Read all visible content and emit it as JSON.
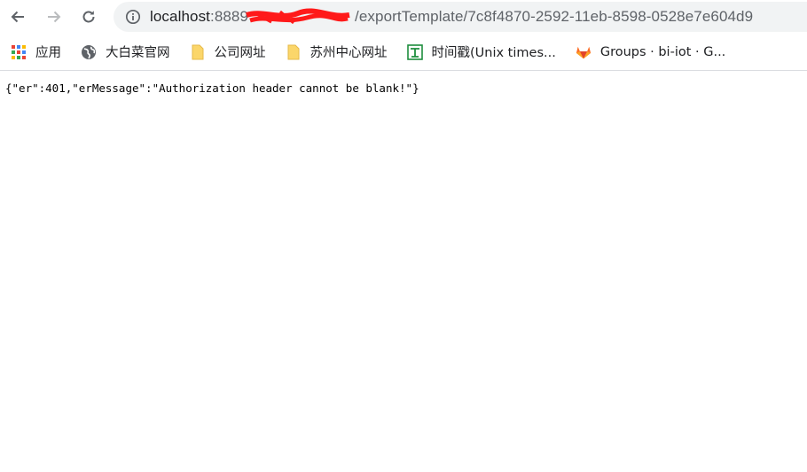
{
  "browser": {
    "url": {
      "host": "localhost",
      "port": ":8889",
      "rest": "/exportTemplate/7c8f4870-2592-11eb-8598-0528e7e604d9"
    }
  },
  "bookmarks": [
    {
      "label": "应用",
      "icon": "apps-grid-icon"
    },
    {
      "label": "大白菜官网",
      "icon": "globe-icon"
    },
    {
      "label": "公司网址",
      "icon": "folder-icon"
    },
    {
      "label": "苏州中心网址",
      "icon": "folder-icon"
    },
    {
      "label": "时间戳(Unix times...",
      "icon": "timestamp-icon"
    },
    {
      "label": "Groups · bi-iot · G...",
      "icon": "gitlab-icon"
    }
  ],
  "page": {
    "body_text": "{\"er\":401,\"erMessage\":\"Authorization header cannot be blank!\"}"
  }
}
